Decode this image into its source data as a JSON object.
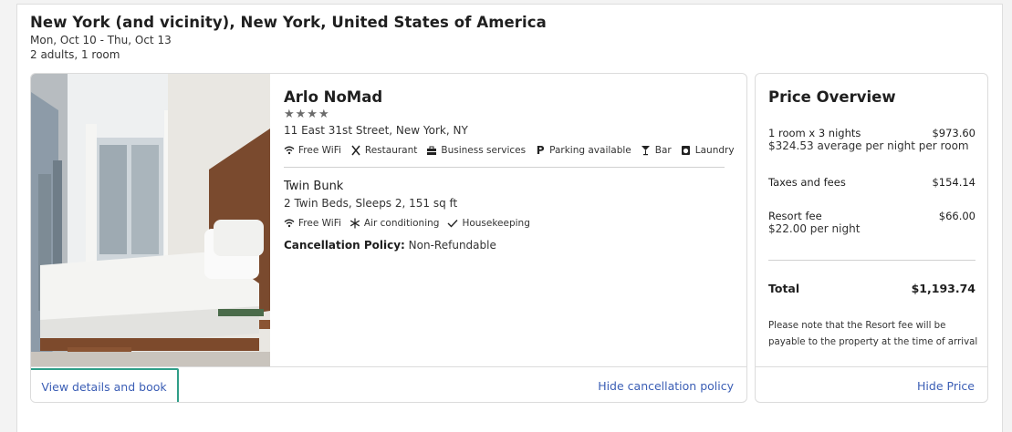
{
  "header": {
    "destination": "New York (and vicinity), New York, United States of America",
    "dates": "Mon, Oct 10 - Thu, Oct 13",
    "guests": "2 adults, 1 room"
  },
  "hotel": {
    "name": "Arlo NoMad",
    "stars": "★★★★",
    "star_count": 4,
    "address": "11 East 31st Street, New York, NY",
    "amenities": [
      {
        "icon": "wifi-icon",
        "label": "Free WiFi"
      },
      {
        "icon": "restaurant-icon",
        "label": "Restaurant"
      },
      {
        "icon": "briefcase-icon",
        "label": "Business services"
      },
      {
        "icon": "parking-icon",
        "label": "Parking available"
      },
      {
        "icon": "bar-icon",
        "label": "Bar"
      },
      {
        "icon": "laundry-icon",
        "label": "Laundry"
      }
    ],
    "room": {
      "name": "Twin Bunk",
      "description": "2 Twin Beds, Sleeps 2, 151 sq ft",
      "amenities": [
        {
          "icon": "wifi-icon",
          "label": "Free WiFi"
        },
        {
          "icon": "snowflake-icon",
          "label": "Air conditioning"
        },
        {
          "icon": "check-icon",
          "label": "Housekeeping"
        }
      ]
    },
    "cancellation_label": "Cancellation Policy:",
    "cancellation_value": "Non-Refundable",
    "book_label": "View details and book",
    "hide_cancellation_label": "Hide cancellation policy"
  },
  "price": {
    "title": "Price Overview",
    "rooms_label": "1 room x 3 nights",
    "rooms_value": "$973.60",
    "average": "$324.53 average per night per room",
    "taxes_label": "Taxes and fees",
    "taxes_value": "$154.14",
    "resort_label": "Resort fee",
    "resort_value": "$66.00",
    "resort_sub": "$22.00 per night",
    "total_label": "Total",
    "total_value": "$1,193.74",
    "note": "Please note that the Resort fee will be payable to the property at the time of arrival",
    "hide_label": "Hide Price"
  },
  "colors": {
    "link": "#3b5eb5",
    "highlight": "#2f9e88"
  }
}
